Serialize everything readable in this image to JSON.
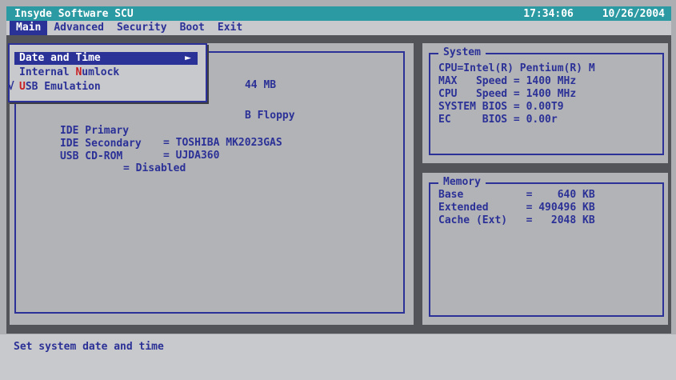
{
  "title_bar": {
    "app_name": "Insyde Software SCU",
    "time": "17:34:06",
    "date": "10/26/2004"
  },
  "menu": {
    "items": [
      "Main",
      "Advanced",
      "Security",
      "Boot",
      "Exit"
    ],
    "active": "Main"
  },
  "main_panel": {
    "rows": [
      {
        "label": "",
        "value": "44 MB"
      },
      {
        "label": "",
        "value": "B Floppy"
      },
      {
        "label": "IDE Primary",
        "value": "= TOSHIBA MK2023GAS"
      },
      {
        "label": "IDE Secondary",
        "value": "= UJDA360"
      },
      {
        "label": "USB CD-ROM",
        "value": "= Disabled"
      }
    ]
  },
  "popup_menu": {
    "items": [
      {
        "pre": "Date and Time",
        "hot": "",
        "post": "",
        "selected": true,
        "arrow": "►"
      },
      {
        "pre": "Internal ",
        "hot": "N",
        "post": "umlock",
        "selected": false
      },
      {
        "pre": "",
        "hot": "U",
        "post": "SB Emulation",
        "selected": false,
        "checked": "√"
      }
    ]
  },
  "system_panel": {
    "title": "System",
    "rows": [
      "CPU=Intel(R) Pentium(R) M",
      "MAX   Speed = 1400 MHz",
      "CPU   Speed = 1400 MHz",
      "SYSTEM BIOS = 0.00T9",
      "EC     BIOS = 0.00r"
    ]
  },
  "memory_panel": {
    "title": "Memory",
    "rows": [
      "Base          =    640 KB",
      "Extended      = 490496 KB",
      "Cache (Ext)   =   2048 KB"
    ]
  },
  "status_bar": {
    "message": "Set system date and time"
  },
  "colors": {
    "background": "#adaeb1",
    "title_bar": "#2c9aa2",
    "workspace": "#52545a",
    "text": "#2b3196",
    "highlight": "#2a3197",
    "hotkey": "#c81e23"
  }
}
